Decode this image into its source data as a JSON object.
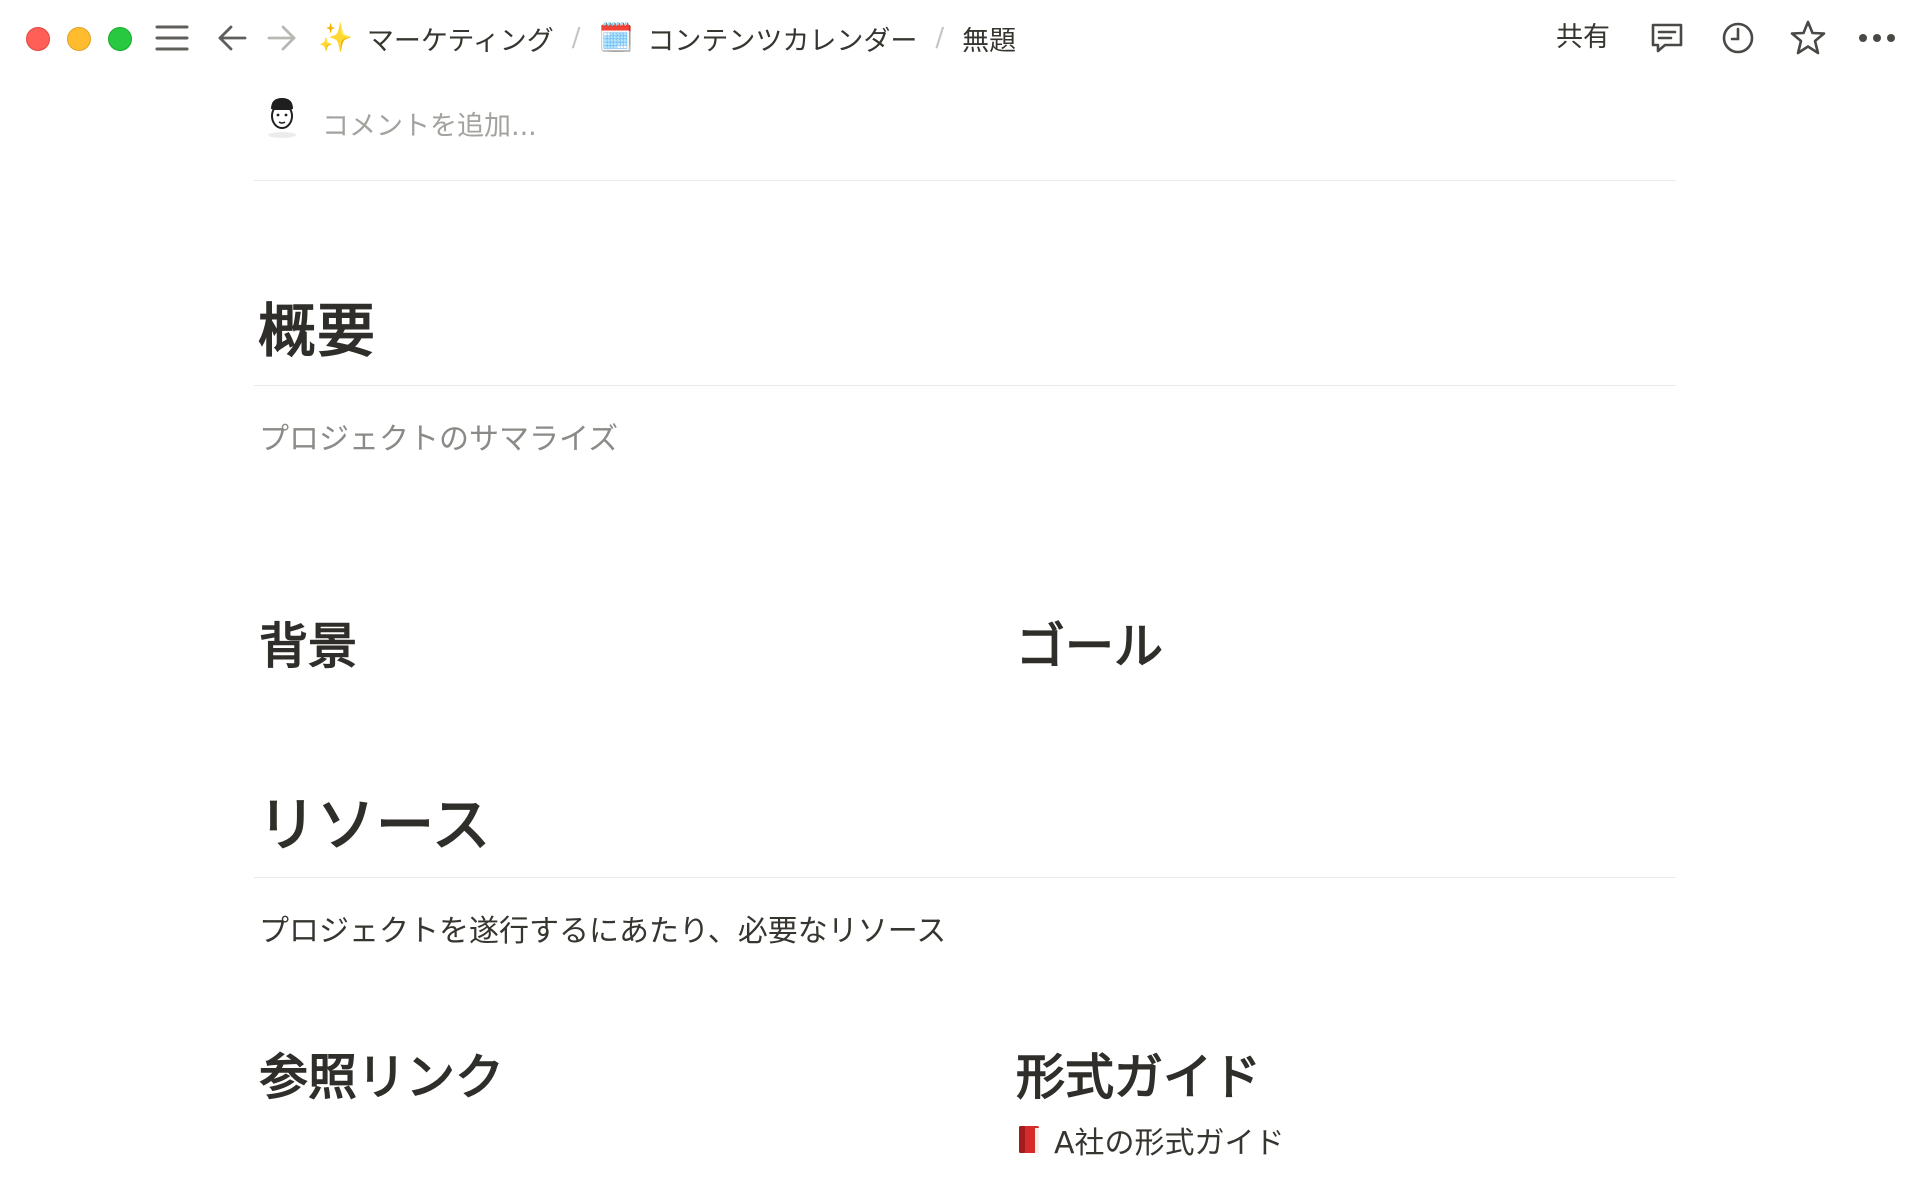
{
  "window": {
    "controls": [
      "close",
      "minimize",
      "maximize"
    ]
  },
  "toolbar": {
    "menu_icon": "hamburger-icon",
    "back_icon": "arrow-left-icon",
    "forward_icon": "arrow-right-icon",
    "breadcrumbs": [
      {
        "emoji": "✨",
        "label": "マーケティング"
      },
      {
        "emoji": "🗓️",
        "label": "コンテンツカレンダー"
      },
      {
        "emoji": "",
        "label": "無題"
      }
    ],
    "separator": "/",
    "share_label": "共有",
    "right_icons": [
      "comment-icon",
      "clock-icon",
      "star-icon",
      "more-icon"
    ]
  },
  "comment": {
    "placeholder": "コメントを追加..."
  },
  "sections": {
    "overview": {
      "heading": "概要",
      "text": "プロジェクトのサマライズ"
    },
    "background": {
      "heading": "背景"
    },
    "goal": {
      "heading": "ゴール"
    },
    "resources": {
      "heading": "リソース",
      "text": "プロジェクトを遂行するにあたり、必要なリソース"
    },
    "reference_links": {
      "heading": "参照リンク"
    },
    "style_guide": {
      "heading": "形式ガイド",
      "items": [
        {
          "icon": "book-icon",
          "label": "A社の形式ガイド"
        }
      ]
    }
  },
  "colors": {
    "text": "#37352f",
    "muted": "#8b8a86",
    "placeholder": "#a3a29e",
    "divider": "#e9e9e7"
  }
}
